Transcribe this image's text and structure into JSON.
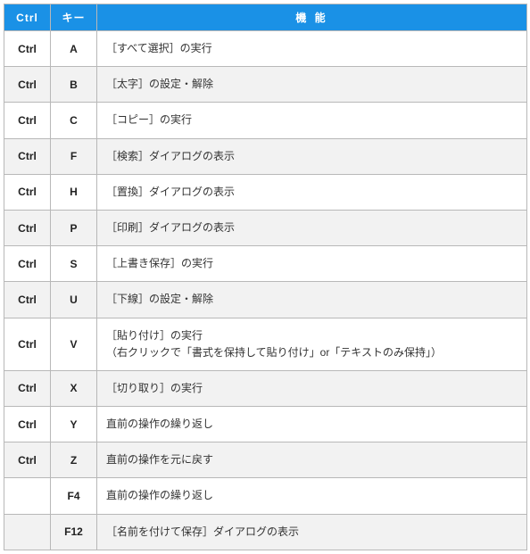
{
  "headers": {
    "ctrl": "Ctrl",
    "key": "キー",
    "func": "機 能"
  },
  "rows": [
    {
      "ctrl": "Ctrl",
      "key": "A",
      "func": "［すべて選択］の実行"
    },
    {
      "ctrl": "Ctrl",
      "key": "B",
      "func": "［太字］の設定・解除"
    },
    {
      "ctrl": "Ctrl",
      "key": "C",
      "func": "［コピー］の実行"
    },
    {
      "ctrl": "Ctrl",
      "key": "F",
      "func": "［検索］ダイアログの表示"
    },
    {
      "ctrl": "Ctrl",
      "key": "H",
      "func": "［置換］ダイアログの表示"
    },
    {
      "ctrl": "Ctrl",
      "key": "P",
      "func": "［印刷］ダイアログの表示"
    },
    {
      "ctrl": "Ctrl",
      "key": "S",
      "func": "［上書き保存］の実行"
    },
    {
      "ctrl": "Ctrl",
      "key": "U",
      "func": "［下線］の設定・解除"
    },
    {
      "ctrl": "Ctrl",
      "key": "V",
      "func": "［貼り付け］の実行\n（右クリックで「書式を保持して貼り付け」or「テキストのみ保持」）"
    },
    {
      "ctrl": "Ctrl",
      "key": "X",
      "func": "［切り取り］の実行"
    },
    {
      "ctrl": "Ctrl",
      "key": "Y",
      "func": "直前の操作の繰り返し"
    },
    {
      "ctrl": "Ctrl",
      "key": "Z",
      "func": "直前の操作を元に戻す"
    },
    {
      "ctrl": "",
      "key": "F4",
      "func": "直前の操作の繰り返し"
    },
    {
      "ctrl": "",
      "key": "F12",
      "func": "［名前を付けて保存］ダイアログの表示"
    }
  ]
}
